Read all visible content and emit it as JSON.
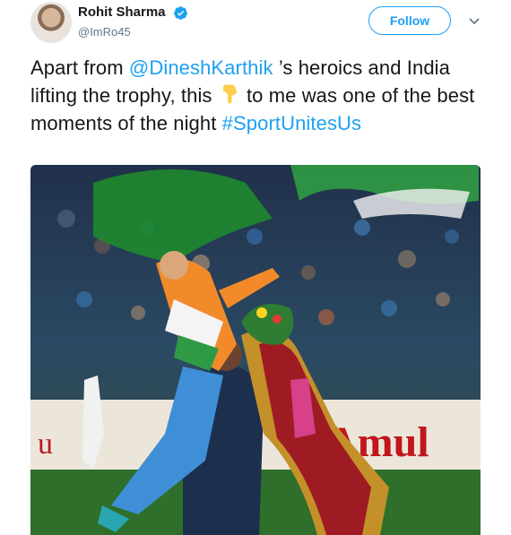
{
  "user": {
    "name": "Rohit Sharma",
    "handle": "@ImRo45",
    "verified": true,
    "avatar_icon": "profile-photo"
  },
  "follow_label": "Follow",
  "menu_icon": "chevron-down-icon",
  "tweet": {
    "text_part1": "Apart from ",
    "mention": "@DineshKarthik",
    "text_part2": " ’s heroics and India lifting the trophy, this ",
    "emoji": "👇",
    "text_part3": " to me was one of the best moments of the night ",
    "hashtag": "#SportUnitesUs"
  },
  "media": {
    "image_icon": "cricket-celebration-photo",
    "banner_text": "Amul",
    "banner_left_text": "u"
  },
  "colors": {
    "accent": "#1da1f2",
    "text": "#14171a",
    "secondary_text": "#657786"
  }
}
